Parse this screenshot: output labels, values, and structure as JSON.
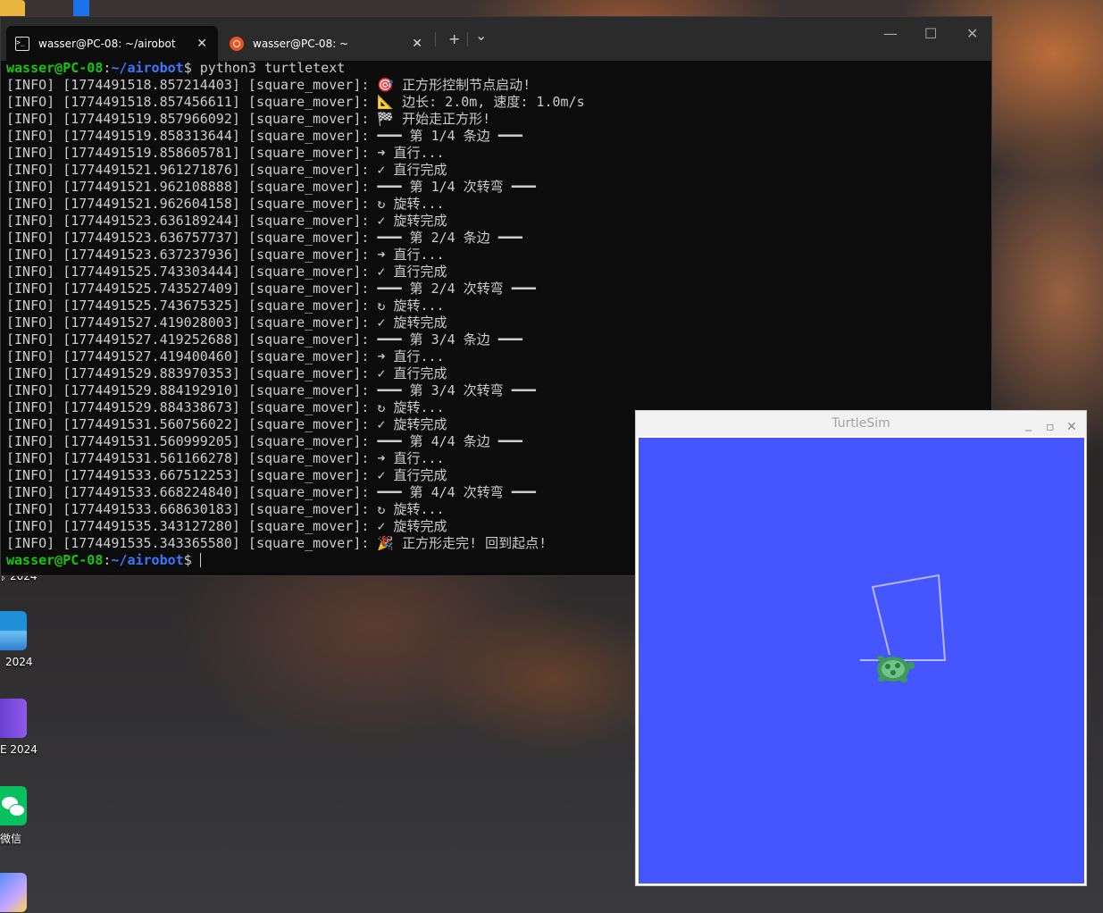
{
  "desktop": {
    "icons": [
      {
        "label": "ᛒ 2024"
      },
      {
        "label": "2024"
      },
      {
        "label": "E 2024"
      },
      {
        "label": "微信"
      },
      {
        "label": ""
      }
    ]
  },
  "terminal": {
    "tabs": [
      {
        "label": "wasser@PC-08: ~/airobot",
        "close": "✕"
      },
      {
        "label": "wasser@PC-08: ~",
        "close": "✕"
      }
    ],
    "new_tab": "+",
    "dropdown": "⌄",
    "controls": {
      "minimize": "—",
      "maximize": "☐",
      "close": "✕"
    },
    "prompt": {
      "user": "wasser@PC-08",
      "colon": ":",
      "path": "~/airobot",
      "dollar": "$"
    },
    "command": "python3 turtletext",
    "lines": [
      "[INFO] [1774491518.857214403] [square_mover]: 🎯 正方形控制节点启动!",
      "[INFO] [1774491518.857456611] [square_mover]: 📐 边长: 2.0m, 速度: 1.0m/s",
      "[INFO] [1774491519.857966092] [square_mover]: 🏁 开始走正方形!",
      "[INFO] [1774491519.858313644] [square_mover]: ━━━ 第 1/4 条边 ━━━",
      "[INFO] [1774491519.858605781] [square_mover]: ➜ 直行...",
      "[INFO] [1774491521.961271876] [square_mover]: ✓ 直行完成",
      "[INFO] [1774491521.962108888] [square_mover]: ━━━ 第 1/4 次转弯 ━━━",
      "[INFO] [1774491521.962604158] [square_mover]: ↻ 旋转...",
      "[INFO] [1774491523.636189244] [square_mover]: ✓ 旋转完成",
      "[INFO] [1774491523.636757737] [square_mover]: ━━━ 第 2/4 条边 ━━━",
      "[INFO] [1774491523.637237936] [square_mover]: ➜ 直行...",
      "[INFO] [1774491525.743303444] [square_mover]: ✓ 直行完成",
      "[INFO] [1774491525.743527409] [square_mover]: ━━━ 第 2/4 次转弯 ━━━",
      "[INFO] [1774491525.743675325] [square_mover]: ↻ 旋转...",
      "[INFO] [1774491527.419028003] [square_mover]: ✓ 旋转完成",
      "[INFO] [1774491527.419252688] [square_mover]: ━━━ 第 3/4 条边 ━━━",
      "[INFO] [1774491527.419400460] [square_mover]: ➜ 直行...",
      "[INFO] [1774491529.883970353] [square_mover]: ✓ 直行完成",
      "[INFO] [1774491529.884192910] [square_mover]: ━━━ 第 3/4 次转弯 ━━━",
      "[INFO] [1774491529.884338673] [square_mover]: ↻ 旋转...",
      "[INFO] [1774491531.560756022] [square_mover]: ✓ 旋转完成",
      "[INFO] [1774491531.560999205] [square_mover]: ━━━ 第 4/4 条边 ━━━",
      "[INFO] [1774491531.561166278] [square_mover]: ➜ 直行...",
      "[INFO] [1774491533.667512253] [square_mover]: ✓ 直行完成",
      "[INFO] [1774491533.668224840] [square_mover]: ━━━ 第 4/4 次转弯 ━━━",
      "[INFO] [1774491533.668630183] [square_mover]: ↻ 旋转...",
      "[INFO] [1774491535.343127280] [square_mover]: ✓ 旋转完成",
      "[INFO] [1774491535.343365580] [square_mover]: 🎉 正方形走完! 回到起点!"
    ]
  },
  "turtlesim": {
    "title": "TurtleSim",
    "controls": {
      "minimize": "_",
      "maximize": "▫",
      "close": "✕"
    },
    "background_color": "#4556ff",
    "pen_color": "#b3b8ff",
    "turtle_color": "#3f9a5a"
  }
}
